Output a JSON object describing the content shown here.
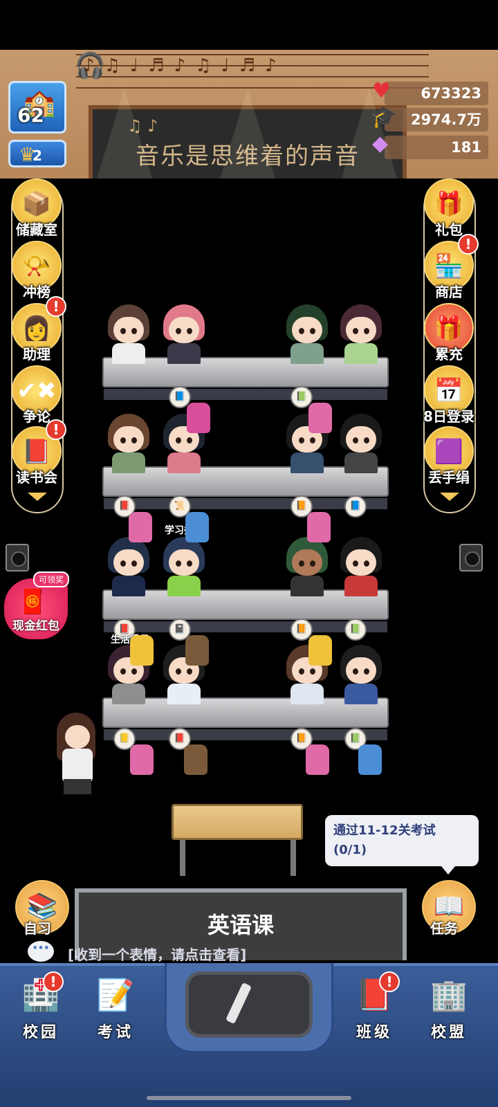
{
  "header": {
    "board_title": "音乐是思维着的声音",
    "level": "62",
    "rank": "2",
    "colors": {
      "accent_red": "#e43b2e",
      "gold": "#f1c75b"
    }
  },
  "resources": [
    {
      "icon": "heart-icon",
      "value": "673323"
    },
    {
      "icon": "graduation-cap-icon",
      "value": "2974.7万"
    },
    {
      "icon": "diamond-icon",
      "value": "181"
    }
  ],
  "left_menu": [
    {
      "icon": "boxes-icon",
      "label": "储藏室",
      "badge": false
    },
    {
      "icon": "trophy-horn-icon",
      "label": "冲榜",
      "badge": false
    },
    {
      "icon": "assistant-girl-icon",
      "label": "助理",
      "badge": true
    },
    {
      "icon": "debate-icon",
      "label": "争论",
      "badge": false
    },
    {
      "icon": "book-club-icon",
      "label": "读书会",
      "badge": true
    }
  ],
  "right_menu": [
    {
      "icon": "gift-box-icon",
      "label": "礼包",
      "badge": false
    },
    {
      "icon": "shop-icon",
      "label": "商店",
      "badge": true
    },
    {
      "icon": "cumulative-recharge-icon",
      "label": "累充",
      "badge": false
    },
    {
      "icon": "calendar-8-icon",
      "label": "8日登录",
      "badge": false
    },
    {
      "icon": "handkerchief-icon",
      "label": "丢手绢",
      "badge": false
    }
  ],
  "badge_mark": "!",
  "roles": {
    "study_monitor": "学习委员",
    "life_monitor": "生活委员"
  },
  "cash_packet": {
    "tag": "可领奖",
    "label": "现金红包"
  },
  "task": {
    "title": "通过11-12关考试",
    "progress": "(0/1)"
  },
  "lesson": {
    "title": "英语课"
  },
  "self_study": {
    "label": "自习"
  },
  "task_button": {
    "label": "任务"
  },
  "chat": {
    "text": "[收到一个表情，请点击查看]"
  },
  "bottom_nav": [
    {
      "icon": "campus-icon",
      "label": "校园",
      "badge": true
    },
    {
      "icon": "exam-paper-icon",
      "label": "考试",
      "badge": false
    },
    {
      "icon": "class-book-icon",
      "label": "班级",
      "badge": true
    },
    {
      "icon": "school-alliance-icon",
      "label": "校盟",
      "badge": false
    }
  ]
}
